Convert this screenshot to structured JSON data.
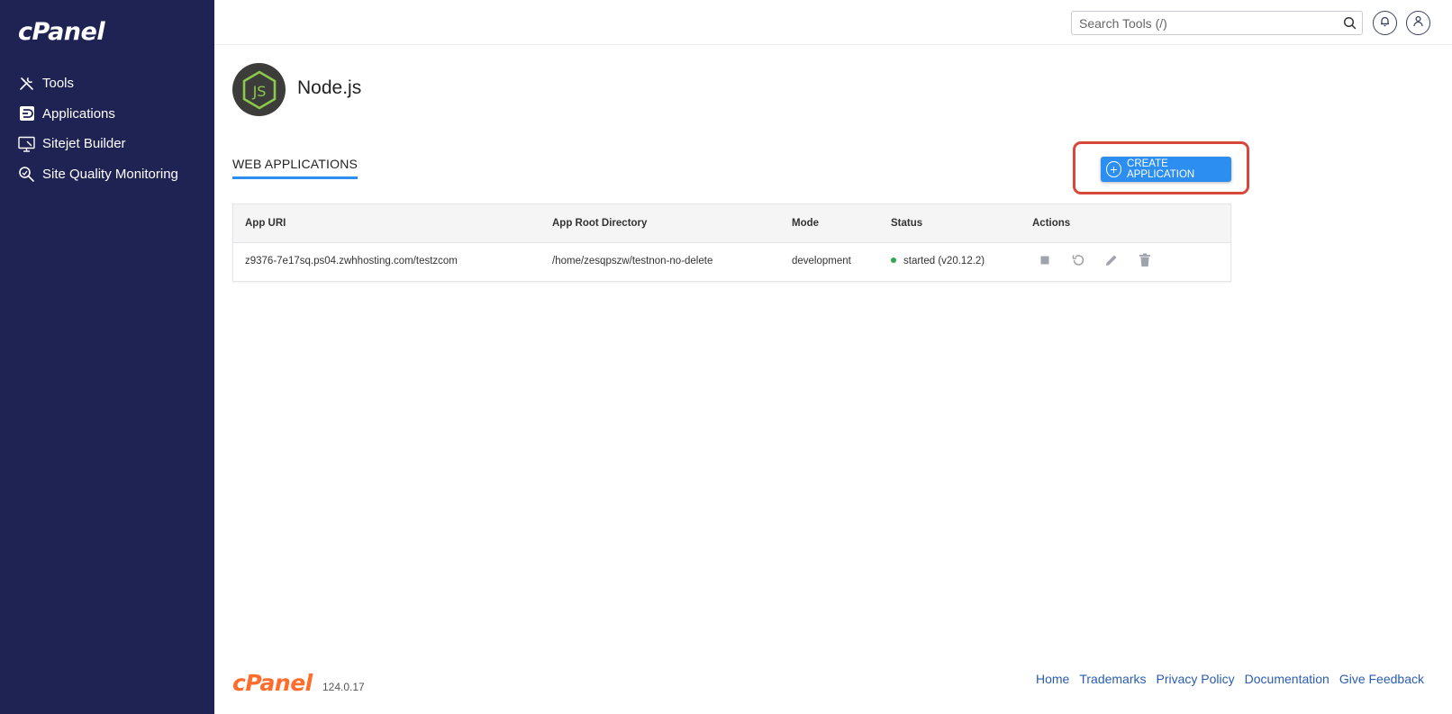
{
  "brand": {
    "name": "cPanel"
  },
  "sidebar": {
    "items": [
      {
        "label": "Tools",
        "icon": "tools-icon"
      },
      {
        "label": "Applications",
        "icon": "applications-icon"
      },
      {
        "label": "Sitejet Builder",
        "icon": "sitejet-icon"
      },
      {
        "label": "Site Quality Monitoring",
        "icon": "magnifier-icon"
      }
    ]
  },
  "topbar": {
    "search_placeholder": "Search Tools (/)"
  },
  "page": {
    "title": "Node.js",
    "tab": "WEB APPLICATIONS",
    "create_button": "CREATE APPLICATION"
  },
  "table": {
    "columns": [
      "App URI",
      "App Root Directory",
      "Mode",
      "Status",
      "Actions"
    ],
    "rows": [
      {
        "uri": "z9376-7e17sq.ps04.zwhhosting.com/testzcom",
        "root": "/home/zesqpszw/testnon-no-delete",
        "mode": "development",
        "status": "started (v20.12.2)"
      }
    ]
  },
  "footer": {
    "logo": "cPanel",
    "version": "124.0.17",
    "links": [
      "Home",
      "Trademarks",
      "Privacy Policy",
      "Documentation",
      "Give Feedback"
    ]
  },
  "colors": {
    "sidebar_bg": "#1f2353",
    "accent": "#2c8ef0",
    "highlight": "#d9473a",
    "status_ok": "#2fa84f",
    "footer_logo": "#ff6c2c"
  }
}
